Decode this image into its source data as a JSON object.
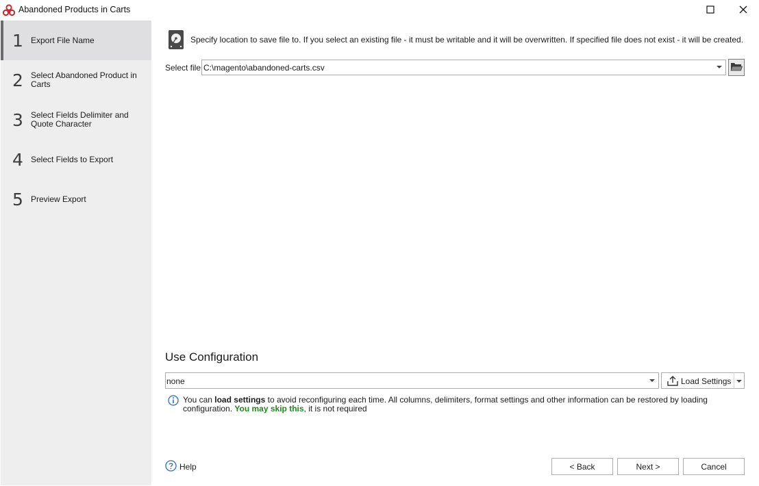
{
  "window": {
    "title": "Abandoned Products in Carts",
    "icon": "app-logo-icon"
  },
  "sidebar": {
    "steps": [
      {
        "number": "1",
        "label": "Export File Name",
        "active": true
      },
      {
        "number": "2",
        "label": "Select Abandoned Product in Carts",
        "active": false
      },
      {
        "number": "3",
        "label": "Select Fields Delimiter and Quote Character",
        "active": false
      },
      {
        "number": "4",
        "label": "Select Fields to Export",
        "active": false
      },
      {
        "number": "5",
        "label": "Preview Export",
        "active": false
      }
    ]
  },
  "main": {
    "info_text": "Specify location to save file to. If you select an existing file - it must be writable and it will be overwritten. If specified file does not exist - it will be created.",
    "select_file_label": "Select file",
    "select_file_value": "C:\\magento\\abandoned-carts.csv",
    "config_heading": "Use Configuration",
    "config_value": "none",
    "load_settings_label": "Load Settings",
    "hint": {
      "part1": "You can ",
      "bold": "load settings",
      "part2": " to avoid reconfiguring each time. All columns, delimiters, format settings and other information can be restored by loading configuration. ",
      "skip": "You may skip this",
      "part3": ", it is not required"
    }
  },
  "footer": {
    "help_label": "Help",
    "back_label": "< Back",
    "next_label": "Next >",
    "cancel_label": "Cancel"
  },
  "colors": {
    "sidebar_bg": "#eeeeef",
    "active_step_bg": "#dfdfe2",
    "skip_green": "#1f8a1f",
    "info_blue": "#2a6fb5"
  }
}
